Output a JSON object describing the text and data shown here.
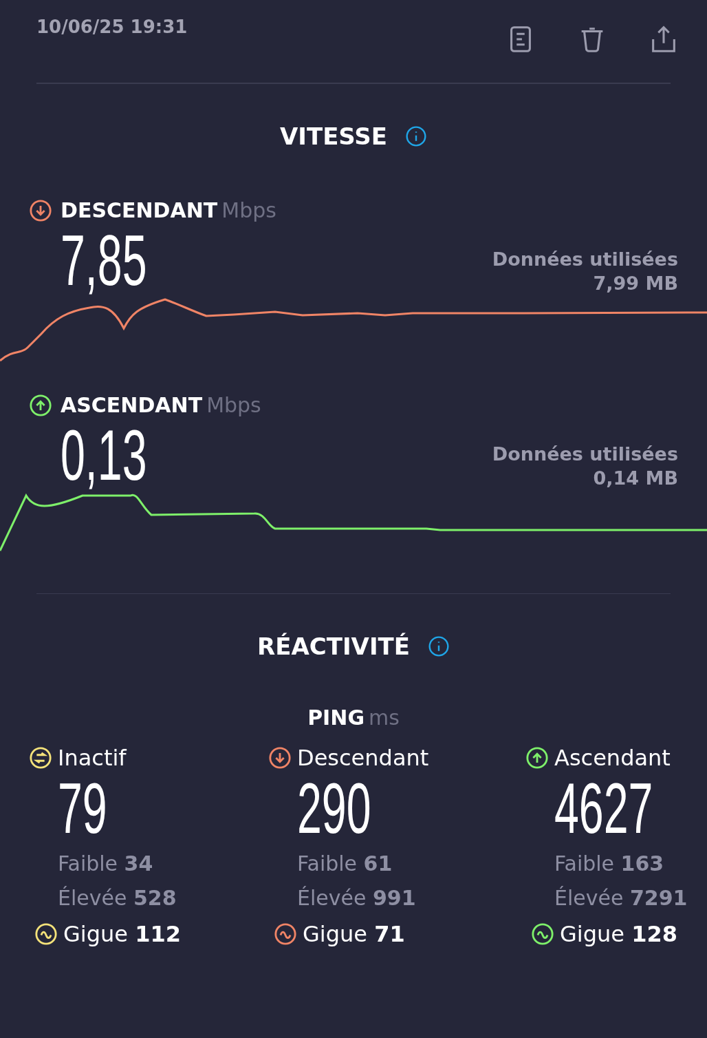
{
  "header": {
    "timestamp": "10/06/25 19:31"
  },
  "speed": {
    "title": "VITESSE",
    "streams": [
      {
        "kind": "down",
        "label": "DESCENDANT",
        "unit": "Mbps",
        "value": "7,85",
        "data_label": "Données utilisées",
        "data_value": "7,99 MB",
        "color": "#f08466"
      },
      {
        "kind": "up",
        "label": "ASCENDANT",
        "unit": "Mbps",
        "value": "0,13",
        "data_label": "Données utilisées",
        "data_value": "0,14 MB",
        "color": "#7ef06a"
      }
    ]
  },
  "responsiveness": {
    "title": "RÉACTIVITÉ",
    "ping_label": "PING",
    "ping_unit": "ms",
    "columns": [
      {
        "kind": "idle",
        "label": "Inactif",
        "value": "79",
        "low": "Faible **34**",
        "high": "Élevée **528**",
        "jitter": "Gigue **112**",
        "color": "#f4e27a"
      },
      {
        "kind": "down",
        "label": "Descendant",
        "value": "290",
        "low": "Faible **61**",
        "high": "Élevée **991**",
        "jitter": "Gigue **71**",
        "color": "#f08466"
      },
      {
        "kind": "up",
        "label": "Ascendant",
        "value": "4627",
        "low": "Faible **163**",
        "high": "Élevée **7291**",
        "jitter": "Gigue **128**",
        "color": "#7ef06a"
      }
    ]
  }
}
